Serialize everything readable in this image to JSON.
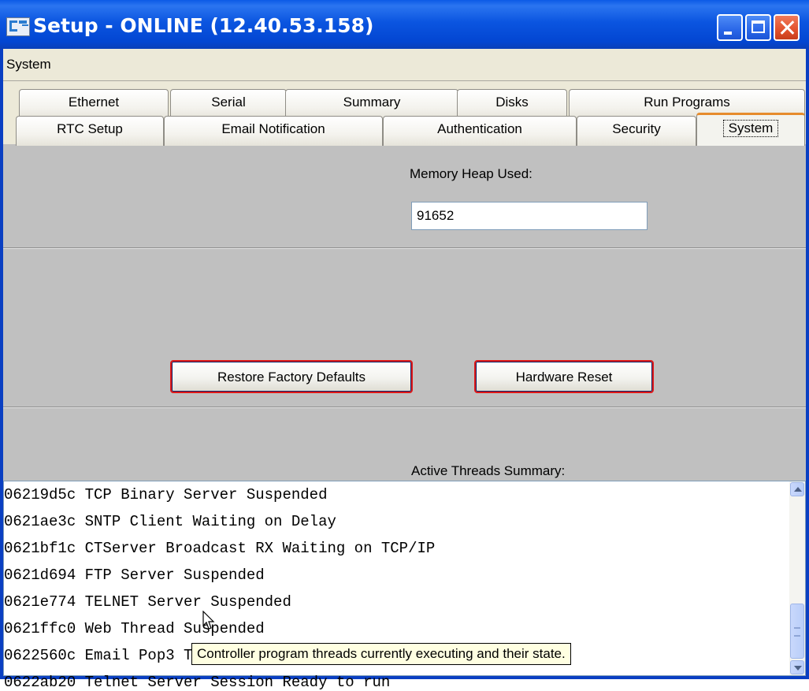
{
  "window": {
    "title": "Setup - ONLINE (12.40.53.158)"
  },
  "menu": {
    "items": [
      "System"
    ]
  },
  "tabs": {
    "row1": [
      "Ethernet",
      "Serial",
      "Summary",
      "Disks",
      "Run Programs"
    ],
    "row2": [
      "RTC Setup",
      "Email Notification",
      "Authentication",
      "Security",
      "System"
    ],
    "selected": "System"
  },
  "system_panel": {
    "memory_heap_label": "Memory Heap Used:",
    "memory_heap_value": "91652",
    "restore_button": "Restore Factory Defaults",
    "reset_button": "Hardware Reset",
    "threads_label": "Active Threads Summary:",
    "threads": [
      "06219d5c TCP Binary Server Suspended",
      "0621ae3c SNTP Client Waiting on Delay",
      "0621bf1c CTServer Broadcast RX Waiting on TCP/IP",
      "0621d694 FTP Server Suspended",
      "0621e774 TELNET Server Suspended",
      "0621ffc0 Web Thread Suspended",
      "0622560c Email Pop3 Thread Waiting on Delay",
      "0622ab20 Telnet Server Session Ready to run"
    ]
  },
  "tooltip": {
    "text": "Controller program threads currently executing and their state."
  },
  "colors": {
    "title_bar": "#0a55e0",
    "panel_bg": "#c0c0c0",
    "button_border": "#e01818",
    "tooltip_bg": "#ffffe1",
    "tab_highlight": "#e68b2c"
  }
}
